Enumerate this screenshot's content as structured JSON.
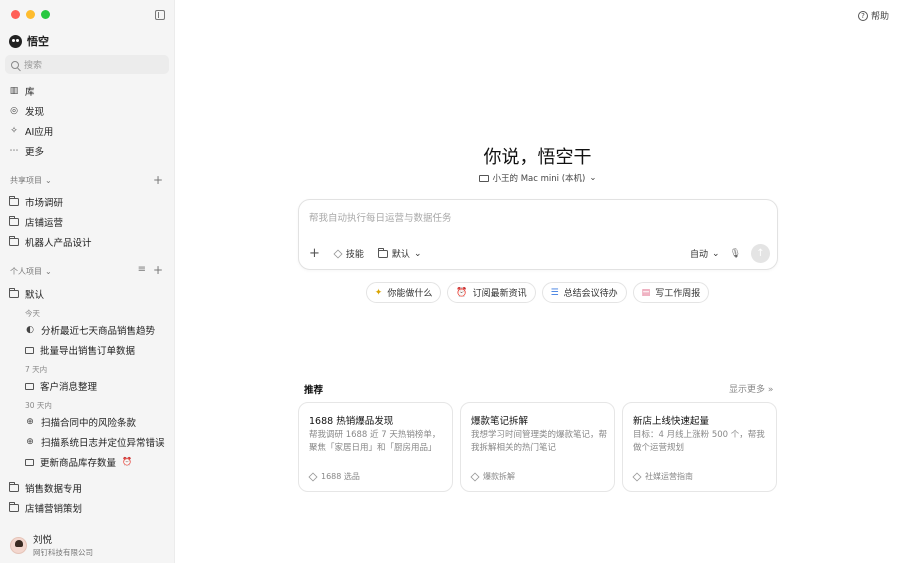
{
  "app": {
    "name": "悟空"
  },
  "search": {
    "placeholder": "搜索"
  },
  "nav": [
    {
      "label": "库",
      "icon": "library-icon"
    },
    {
      "label": "发现",
      "icon": "planet-icon"
    },
    {
      "label": "AI应用",
      "icon": "ai-apps-icon"
    },
    {
      "label": "更多",
      "icon": "more-icon"
    }
  ],
  "shared": {
    "label": "共享项目",
    "items": [
      "市场调研",
      "店铺运营",
      "机器人产品设计"
    ]
  },
  "personal": {
    "label": "个人项目",
    "default_folder": "默认",
    "groups": [
      {
        "label": "今天",
        "tasks": [
          "分析最近七天商品销售趋势",
          "批量导出销售订单数据"
        ]
      },
      {
        "label": "7 天内",
        "tasks": [
          "客户消息整理"
        ]
      },
      {
        "label": "30 天内",
        "tasks": [
          "扫描合同中的风险条款",
          "扫描系统日志并定位异常错误",
          "更新商品库存数量"
        ]
      }
    ],
    "folders": [
      "销售数据专用",
      "店铺营销策划"
    ]
  },
  "user": {
    "name": "刘悦",
    "org": "网钉科技有限公司"
  },
  "header": {
    "help": "帮助"
  },
  "main": {
    "headline": "你说，悟空干",
    "device": "小王的 Mac mini (本机)",
    "composer": {
      "placeholder": "帮我自动执行每日运营与数据任务",
      "skills": "技能",
      "folder": "默认",
      "mode": "自动"
    },
    "chips": [
      "你能做什么",
      "订阅最新资讯",
      "总结会议待办",
      "写工作周报"
    ],
    "recommend": {
      "title": "推荐",
      "more": "显示更多",
      "cards": [
        {
          "title": "1688 热销爆品发现",
          "desc": "帮我调研 1688 近 7 天热销榜单，聚焦「家居日用」和「厨房用品」",
          "tag": "1688 选品"
        },
        {
          "title": "爆款笔记拆解",
          "desc": "我想学习时间管理类的爆款笔记，帮我拆解相关的热门笔记",
          "tag": "爆款拆解"
        },
        {
          "title": "新店上线快速起量",
          "desc": "目标：4 月线上涨粉 500 个，帮我做个运营规划",
          "tag": "社媒运营指南"
        }
      ]
    }
  },
  "colors": {
    "close": "#ff5f57",
    "minimize": "#febc2e",
    "zoom": "#28c840",
    "sidebar_bg": "#f5f5f5"
  }
}
